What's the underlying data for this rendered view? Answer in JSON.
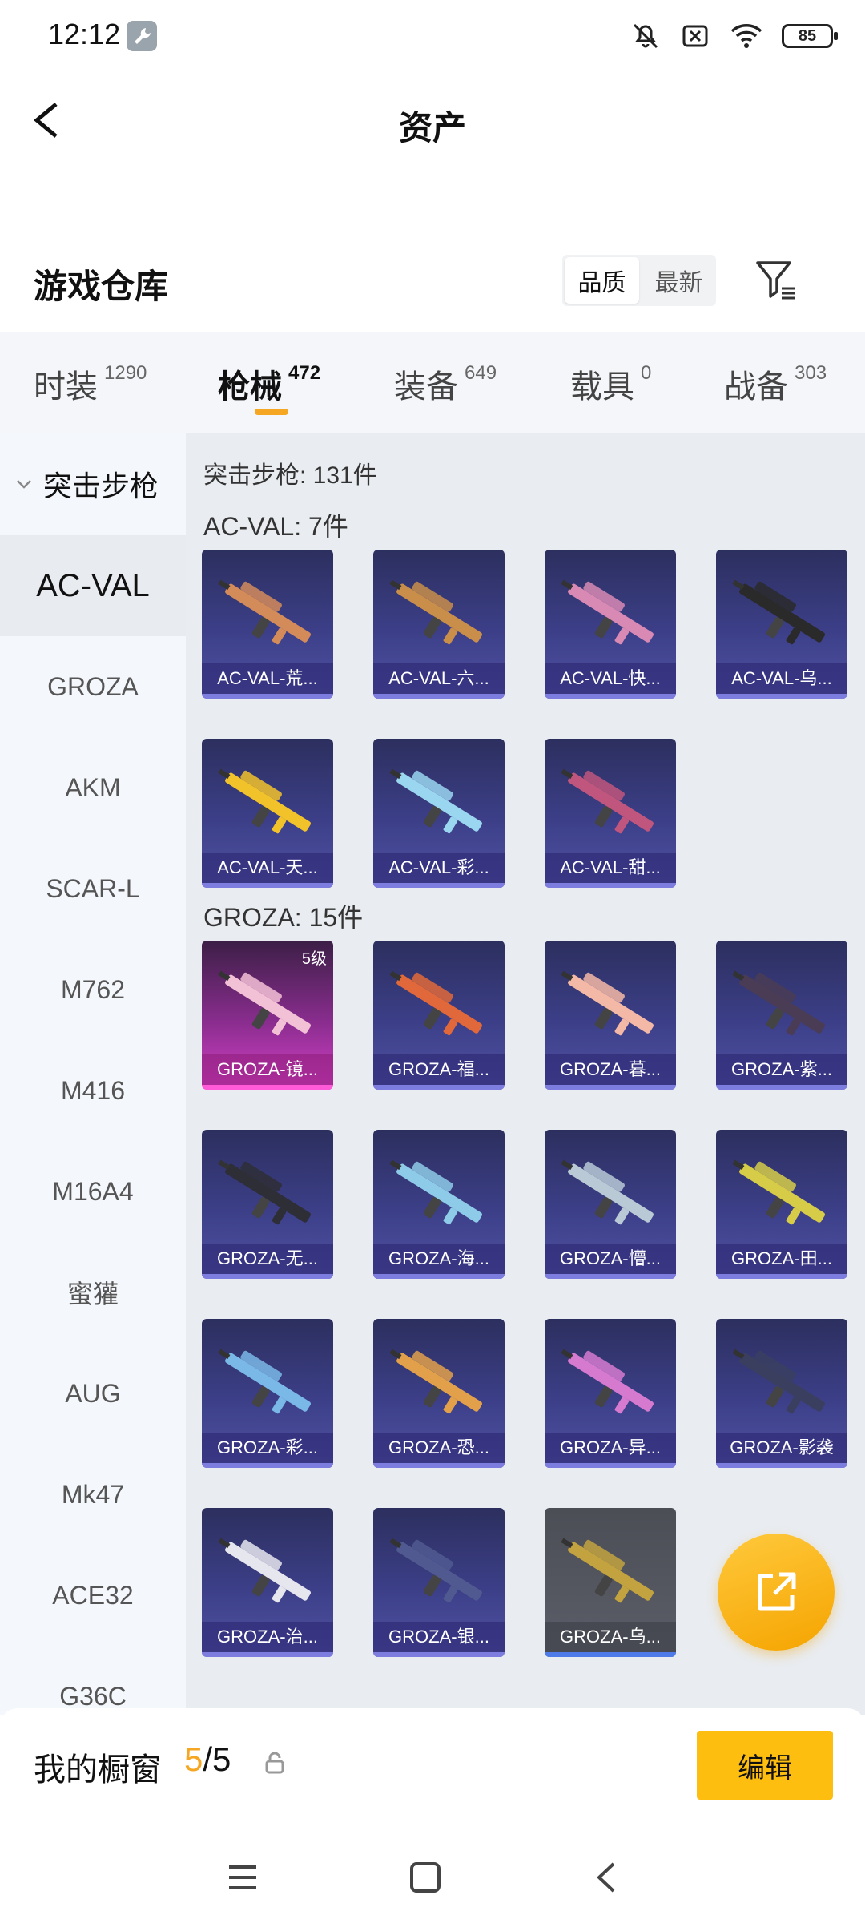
{
  "status": {
    "time": "12:12",
    "battery": "85"
  },
  "header": {
    "title": "资产"
  },
  "section": {
    "title": "游戏仓库",
    "sort_options": [
      "品质",
      "最新"
    ]
  },
  "tabs": [
    {
      "label": "时装",
      "count": "1290"
    },
    {
      "label": "枪械",
      "count": "472"
    },
    {
      "label": "装备",
      "count": "649"
    },
    {
      "label": "载具",
      "count": "0"
    },
    {
      "label": "战备",
      "count": "303"
    }
  ],
  "sidebar": {
    "category": "突击步枪",
    "items": [
      "AC-VAL",
      "GROZA",
      "AKM",
      "SCAR-L",
      "M762",
      "M416",
      "M16A4",
      "蜜獾",
      "AUG",
      "Mk47",
      "ACE32",
      "G36C"
    ]
  },
  "main": {
    "summary": "突击步枪: 131件",
    "groups": [
      {
        "title": "AC-VAL: 7件",
        "cards": [
          {
            "label": "AC-VAL-荒...",
            "style": "blue"
          },
          {
            "label": "AC-VAL-六...",
            "style": "blue"
          },
          {
            "label": "AC-VAL-快...",
            "style": "blue"
          },
          {
            "label": "AC-VAL-乌...",
            "style": "blue"
          },
          {
            "label": "AC-VAL-天...",
            "style": "blue"
          },
          {
            "label": "AC-VAL-彩...",
            "style": "blue"
          },
          {
            "label": "AC-VAL-甜...",
            "style": "blue"
          }
        ]
      },
      {
        "title": "GROZA: 15件",
        "cards": [
          {
            "label": "GROZA-镜...",
            "style": "pink",
            "badge": "5级"
          },
          {
            "label": "GROZA-福...",
            "style": "blue"
          },
          {
            "label": "GROZA-暮...",
            "style": "blue"
          },
          {
            "label": "GROZA-紫...",
            "style": "blue"
          },
          {
            "label": "GROZA-无...",
            "style": "blue"
          },
          {
            "label": "GROZA-海...",
            "style": "blue"
          },
          {
            "label": "GROZA-懵...",
            "style": "blue"
          },
          {
            "label": "GROZA-田...",
            "style": "blue"
          },
          {
            "label": "GROZA-彩...",
            "style": "blue"
          },
          {
            "label": "GROZA-恐...",
            "style": "blue"
          },
          {
            "label": "GROZA-异...",
            "style": "blue"
          },
          {
            "label": "GROZA-影袭",
            "style": "blue"
          },
          {
            "label": "GROZA-治...",
            "style": "blue"
          },
          {
            "label": "GROZA-银...",
            "style": "blue"
          },
          {
            "label": "GROZA-乌...",
            "style": "gray"
          }
        ]
      }
    ]
  },
  "showcase": {
    "label": "我的橱窗",
    "used": "5",
    "total": "/5",
    "edit_label": "编辑"
  },
  "colors": {
    "accent": "#f5a623",
    "edit_button": "#fdbe10",
    "card_blue": "#3c3f88",
    "card_pink": "#d640c6"
  }
}
